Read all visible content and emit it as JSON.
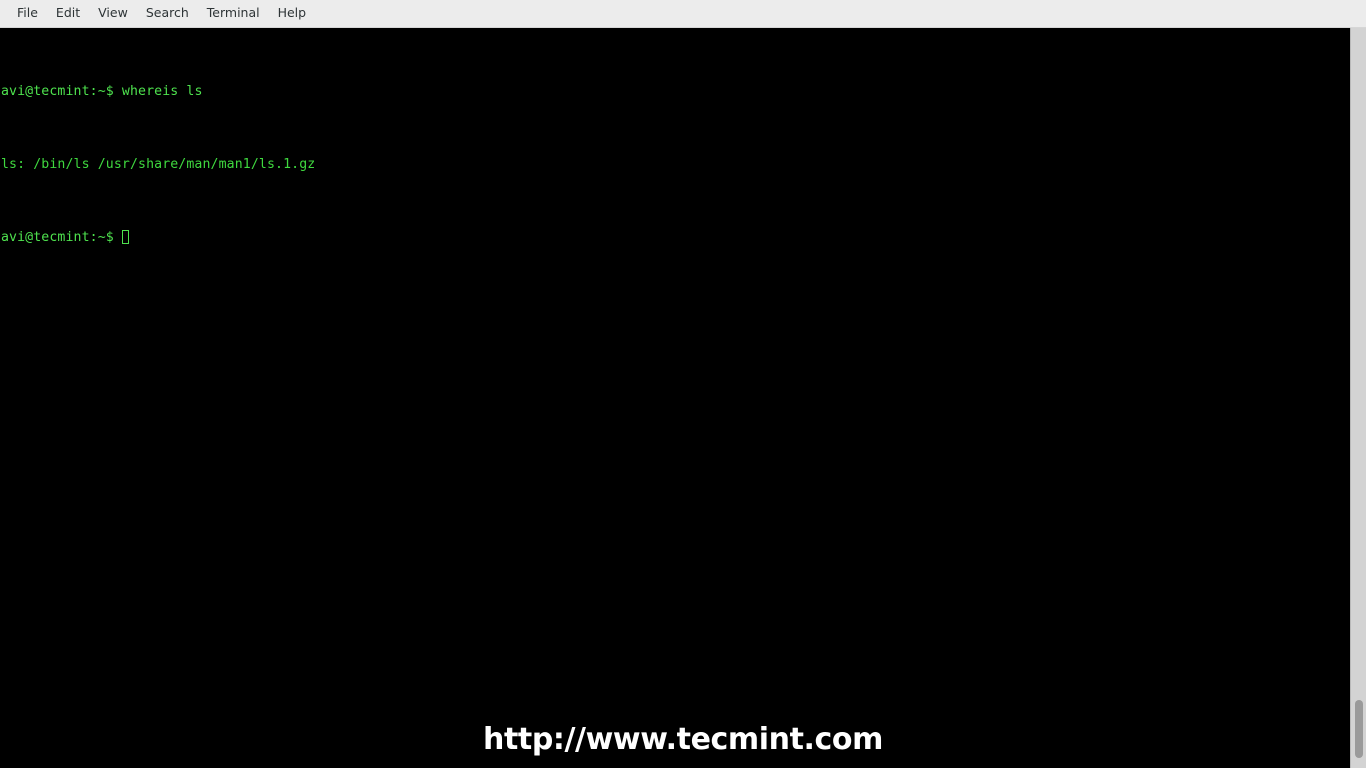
{
  "window": {
    "title": "Terminal",
    "background_color": "#000000"
  },
  "menubar": {
    "background_color": "#ececec",
    "items": [
      {
        "label": "File",
        "name": "menu-file"
      },
      {
        "label": "Edit",
        "name": "menu-edit"
      },
      {
        "label": "View",
        "name": "menu-view"
      },
      {
        "label": "Search",
        "name": "menu-search"
      },
      {
        "label": "Terminal",
        "name": "menu-terminal"
      },
      {
        "label": "Help",
        "name": "menu-help"
      }
    ]
  },
  "terminal": {
    "foreground_color": "#4ee24e",
    "background_color": "#000000",
    "prompt": "avi@tecmint:~$",
    "lines": [
      {
        "type": "command",
        "prompt": "avi@tecmint:~$",
        "space": " ",
        "command": "whereis ls"
      },
      {
        "type": "output",
        "text": "ls: /bin/ls /usr/share/man/man1/ls.1.gz"
      },
      {
        "type": "prompt",
        "prompt": "avi@tecmint:~$",
        "space": " ",
        "cursor": "block-cursor"
      }
    ]
  },
  "scrollbar": {
    "name": "vertical-scrollbar",
    "trough_color": "#d3d3d3",
    "thumb_color": "#9a9a9a",
    "thumb_position": "bottom"
  },
  "watermark": {
    "text": "http://www.tecmint.com",
    "color": "#ffffff"
  }
}
